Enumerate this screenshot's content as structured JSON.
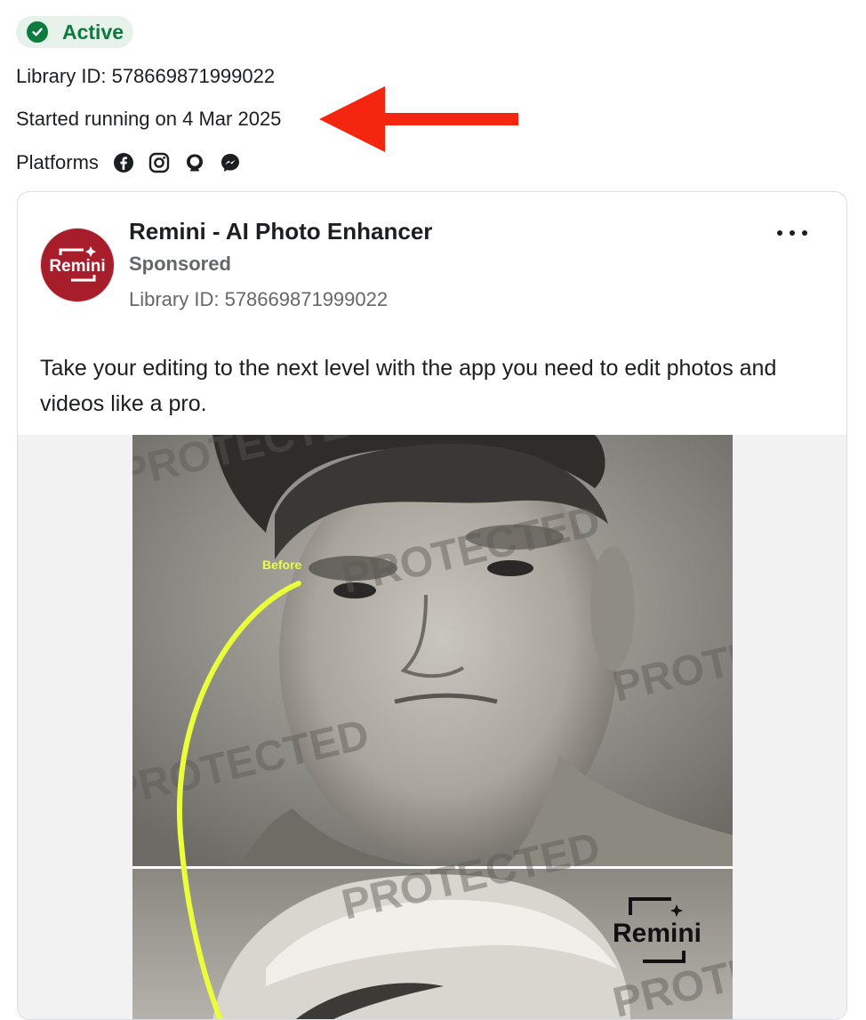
{
  "status": {
    "label": "Active",
    "color": "#0d7a3e",
    "icon": "check-circle-icon"
  },
  "meta": {
    "library_id": "Library ID: 578669871999022",
    "started_running": "Started running on 4 Mar 2025",
    "platforms_label": "Platforms",
    "platform_icons": [
      "facebook-icon",
      "instagram-icon",
      "audience-network-icon",
      "messenger-icon"
    ]
  },
  "annotation": {
    "type": "arrow",
    "color": "#f5260f",
    "points_to": "started_running"
  },
  "ad": {
    "advertiser": "Remini - AI Photo Enhancer",
    "sponsored": "Sponsored",
    "library_id": "Library ID: 578669871999022",
    "body": "Take your editing to the next level with the app you need to edit photos and videos like a pro.",
    "avatar_logo_text": "Remini",
    "more_icon": "more-horizontal-icon",
    "image": {
      "before_label": "Before",
      "watermark": "PROTECTED",
      "logo_text": "Remini"
    }
  }
}
